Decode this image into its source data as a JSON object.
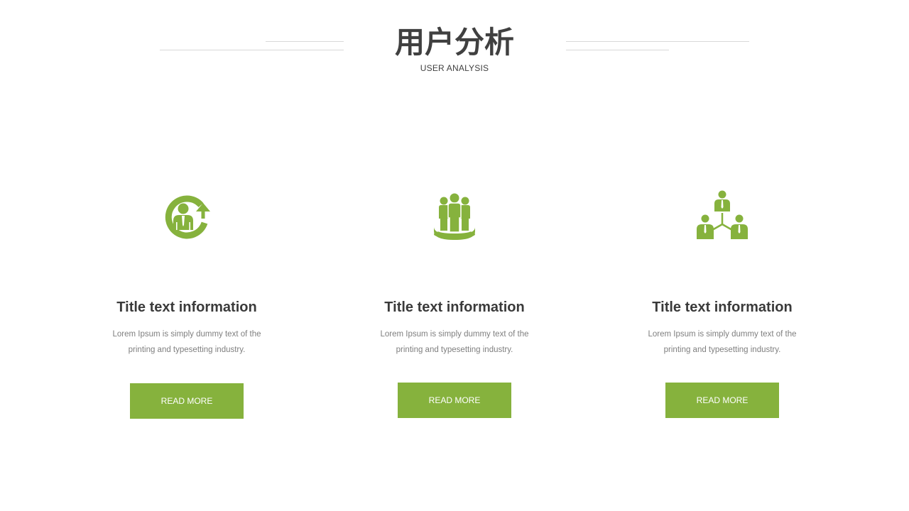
{
  "header": {
    "title": "用户分析",
    "subtitle": "USER ANALYSIS"
  },
  "colors": {
    "accent": "#86b23d",
    "title_text": "#404040",
    "body_text": "#7f7f7f",
    "rule_line": "#d9d9d9"
  },
  "cards": [
    {
      "icon": "user-growth-icon",
      "title": "Title text information",
      "description": "Lorem Ipsum is simply dummy text of the printing and typesetting industry.",
      "button_label": "READ MORE"
    },
    {
      "icon": "team-group-icon",
      "title": "Title text information",
      "description": "Lorem Ipsum is simply dummy text of the printing and typesetting industry.",
      "button_label": "READ MORE"
    },
    {
      "icon": "user-network-icon",
      "title": "Title text information",
      "description": "Lorem Ipsum is simply dummy text of the printing and typesetting industry.",
      "button_label": "READ MORE"
    }
  ]
}
